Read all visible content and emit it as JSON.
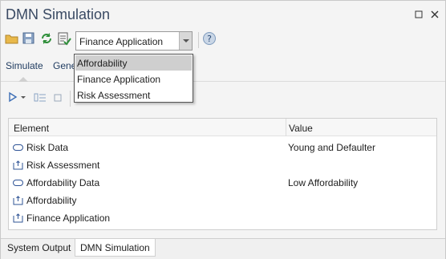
{
  "window": {
    "title": "DMN Simulation",
    "restore_icon": "restore-icon",
    "close_icon": "close-icon"
  },
  "toolbar": {
    "buttons": [
      "open-folder-icon",
      "save-icon",
      "refresh-icon",
      "validate-icon"
    ],
    "combo_value": "Finance Application",
    "help_icon": "help-icon"
  },
  "tabs": {
    "simulate": "Simulate",
    "generate": "Gene"
  },
  "dropdown": {
    "options": [
      "Affordability",
      "Finance Application",
      "Risk Assessment"
    ],
    "selected": "Affordability"
  },
  "grid": {
    "headers": {
      "element": "Element",
      "value": "Value"
    },
    "rows": [
      {
        "icon": "input-data-icon",
        "name": "Risk Data",
        "value": "Young and Defaulter"
      },
      {
        "icon": "decision-icon",
        "name": "Risk Assessment",
        "value": ""
      },
      {
        "icon": "input-data-icon",
        "name": "Affordability Data",
        "value": "Low Affordability"
      },
      {
        "icon": "decision-icon",
        "name": "Affordability",
        "value": ""
      },
      {
        "icon": "decision-icon",
        "name": "Finance Application",
        "value": ""
      }
    ]
  },
  "bottom_tabs": {
    "system_output": "System Output",
    "dmn_simulation": "DMN Simulation"
  },
  "colors": {
    "title": "#3a4a63",
    "accent": "#1e3a5f",
    "selection": "#cfcfcf"
  }
}
